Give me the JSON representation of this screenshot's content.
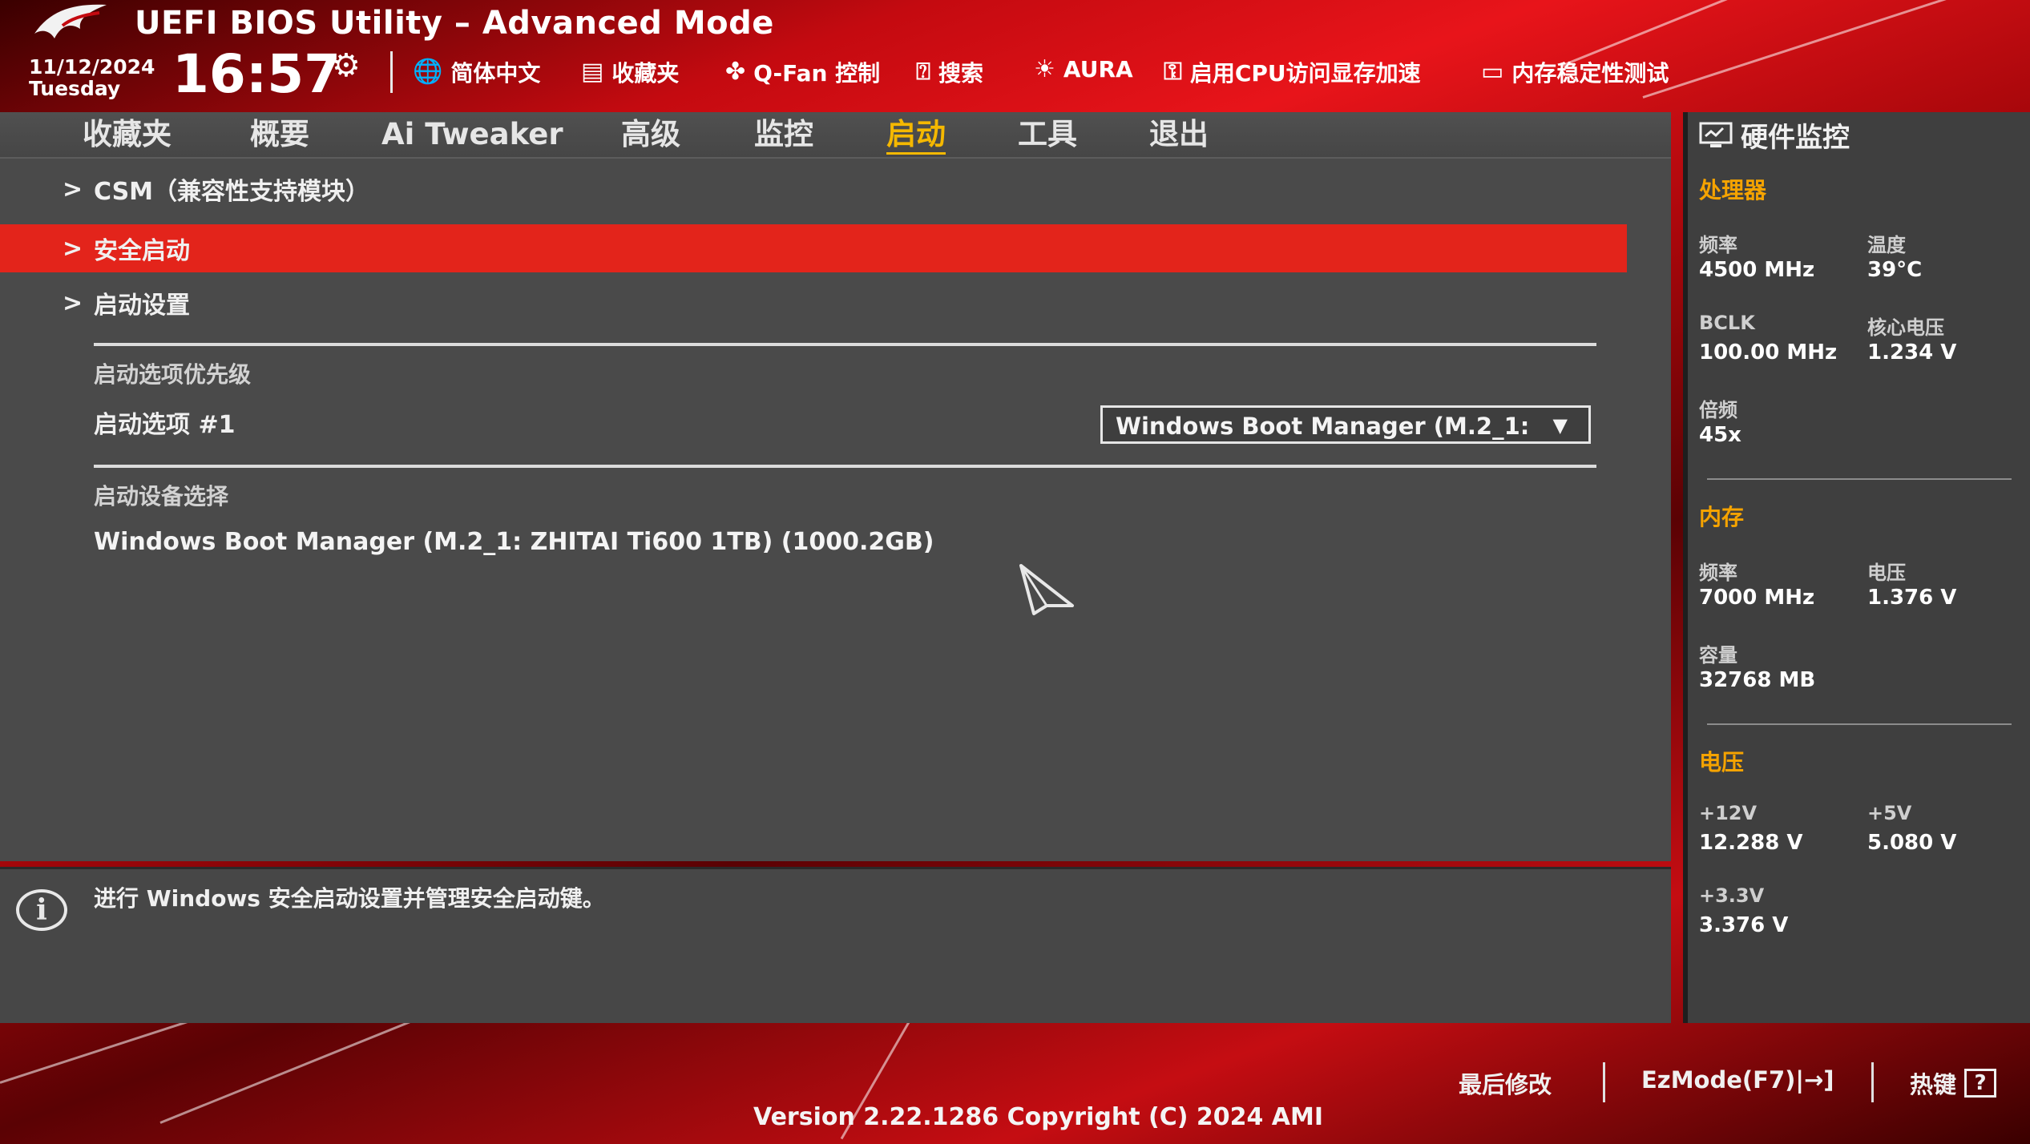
{
  "header": {
    "title": "UEFI BIOS Utility – Advanced Mode",
    "date": "11/12/2024",
    "weekday": "Tuesday",
    "time": "16:57",
    "tools": [
      {
        "icon": "globe-icon",
        "label": "简体中文"
      },
      {
        "icon": "bookmark-icon",
        "label": "收藏夹"
      },
      {
        "icon": "fan-icon",
        "label": "Q-Fan 控制"
      },
      {
        "icon": "question-icon",
        "label": "搜索"
      },
      {
        "icon": "aura-icon",
        "label": "AURA"
      },
      {
        "icon": "cpu-memory-icon",
        "label": "启用CPU访问显存加速"
      },
      {
        "icon": "memory-icon",
        "label": "内存稳定性测试"
      }
    ]
  },
  "tabs": [
    "收藏夹",
    "概要",
    "Ai Tweaker",
    "高级",
    "监控",
    "启动",
    "工具",
    "退出"
  ],
  "active_tab": "启动",
  "menu": {
    "items": [
      "CSM（兼容性支持模块）",
      "安全启动",
      "启动设置"
    ],
    "selected": "安全启动",
    "boot_priority_title": "启动选项优先级",
    "boot_option_label": "启动选项 #1",
    "boot_option_value": "Windows Boot Manager (M.2_1:",
    "device_select_title": "启动设备选择",
    "device_item": "Windows Boot Manager (M.2_1: ZHITAI Ti600 1TB) (1000.2GB)"
  },
  "help": {
    "text": "进行 Windows 安全启动设置并管理安全启动键。"
  },
  "hw_monitor": {
    "title": "硬件监控",
    "cpu": {
      "title": "处理器",
      "freq_label": "频率",
      "freq_value": "4500 MHz",
      "temp_label": "温度",
      "temp_value": "39°C",
      "bclk_label": "BCLK",
      "bclk_value": "100.00 MHz",
      "vcore_label": "核心电压",
      "vcore_value": "1.234 V",
      "ratio_label": "倍频",
      "ratio_value": "45x"
    },
    "memory": {
      "title": "内存",
      "freq_label": "频率",
      "freq_value": "7000 MHz",
      "volt_label": "电压",
      "volt_value": "1.376 V",
      "cap_label": "容量",
      "cap_value": "32768 MB"
    },
    "voltage": {
      "title": "电压",
      "v12_label": "+12V",
      "v12_value": "12.288 V",
      "v5_label": "+5V",
      "v5_value": "5.080 V",
      "v33_label": "+3.3V",
      "v33_value": "3.376 V"
    }
  },
  "footer": {
    "last_modified": "最后修改",
    "ezmode": "EzMode(F7)|→]",
    "hotkeys": "热键",
    "version": "Version 2.22.1286 Copyright (C) 2024 AMI"
  },
  "colors": {
    "accent_red": "#e3241b",
    "active_tab": "#f5b800",
    "section_orange": "#f5a300",
    "panel_gray": "#4a4a4a"
  }
}
